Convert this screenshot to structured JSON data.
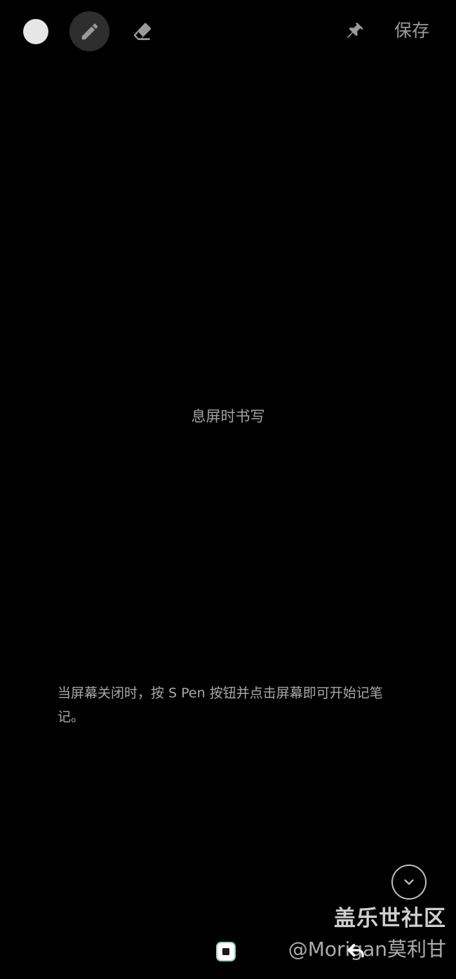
{
  "toolbar": {
    "color_icon": "color-dot-icon",
    "pen_icon": "pencil-icon",
    "eraser_icon": "eraser-icon",
    "pin_icon": "pin-icon",
    "save_label": "保存"
  },
  "canvas": {
    "title": "息屏时书写",
    "instructions": "当屏幕关闭时，按 S Pen 按钮并点击屏幕即可开始记笔记。"
  },
  "collapse": {
    "icon": "chevron-down-icon"
  },
  "watermark": {
    "title": "盖乐世社区",
    "user": "@Morigan莫利甘"
  },
  "navbar": {
    "recents_icon": "recents-icon",
    "back_icon": "back-icon"
  },
  "colors": {
    "background": "#000000",
    "selected_pen_bg": "#2e2e2e",
    "color_dot": "#e6e6e6",
    "text": "#a3a3a3"
  }
}
